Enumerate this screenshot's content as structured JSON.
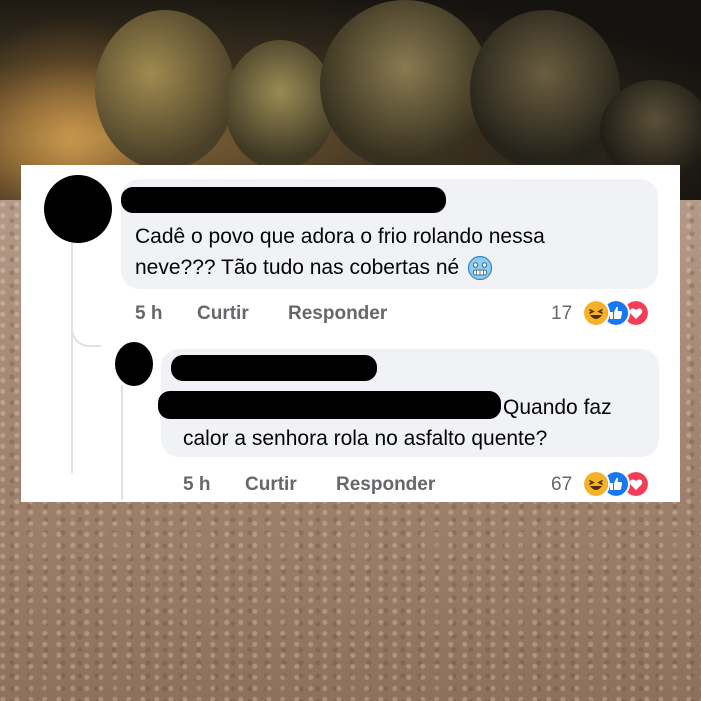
{
  "comment": {
    "text_line1": "Cadê o povo que adora o frio rolando nessa",
    "text_line2": "neve??? Tão tudo nas cobertas né",
    "emoji": "cold-face-emoji",
    "time": "5 h",
    "like_label": "Curtir",
    "reply_label": "Responder",
    "reaction_count": "17",
    "reactions": [
      "haha",
      "like",
      "love"
    ]
  },
  "reply": {
    "text_line1_suffix": "Quando faz",
    "text_line2": "calor a senhora rola no asfalto quente?",
    "time": "5 h",
    "like_label": "Curtir",
    "reply_label": "Responder",
    "reaction_count": "67",
    "reactions": [
      "haha",
      "like",
      "love"
    ]
  },
  "colors": {
    "bubble": "#f0f2f5",
    "meta_text": "#65676b",
    "like_blue": "#1877f2",
    "love_red": "#f33e58",
    "haha_yellow": "#f7b125"
  }
}
